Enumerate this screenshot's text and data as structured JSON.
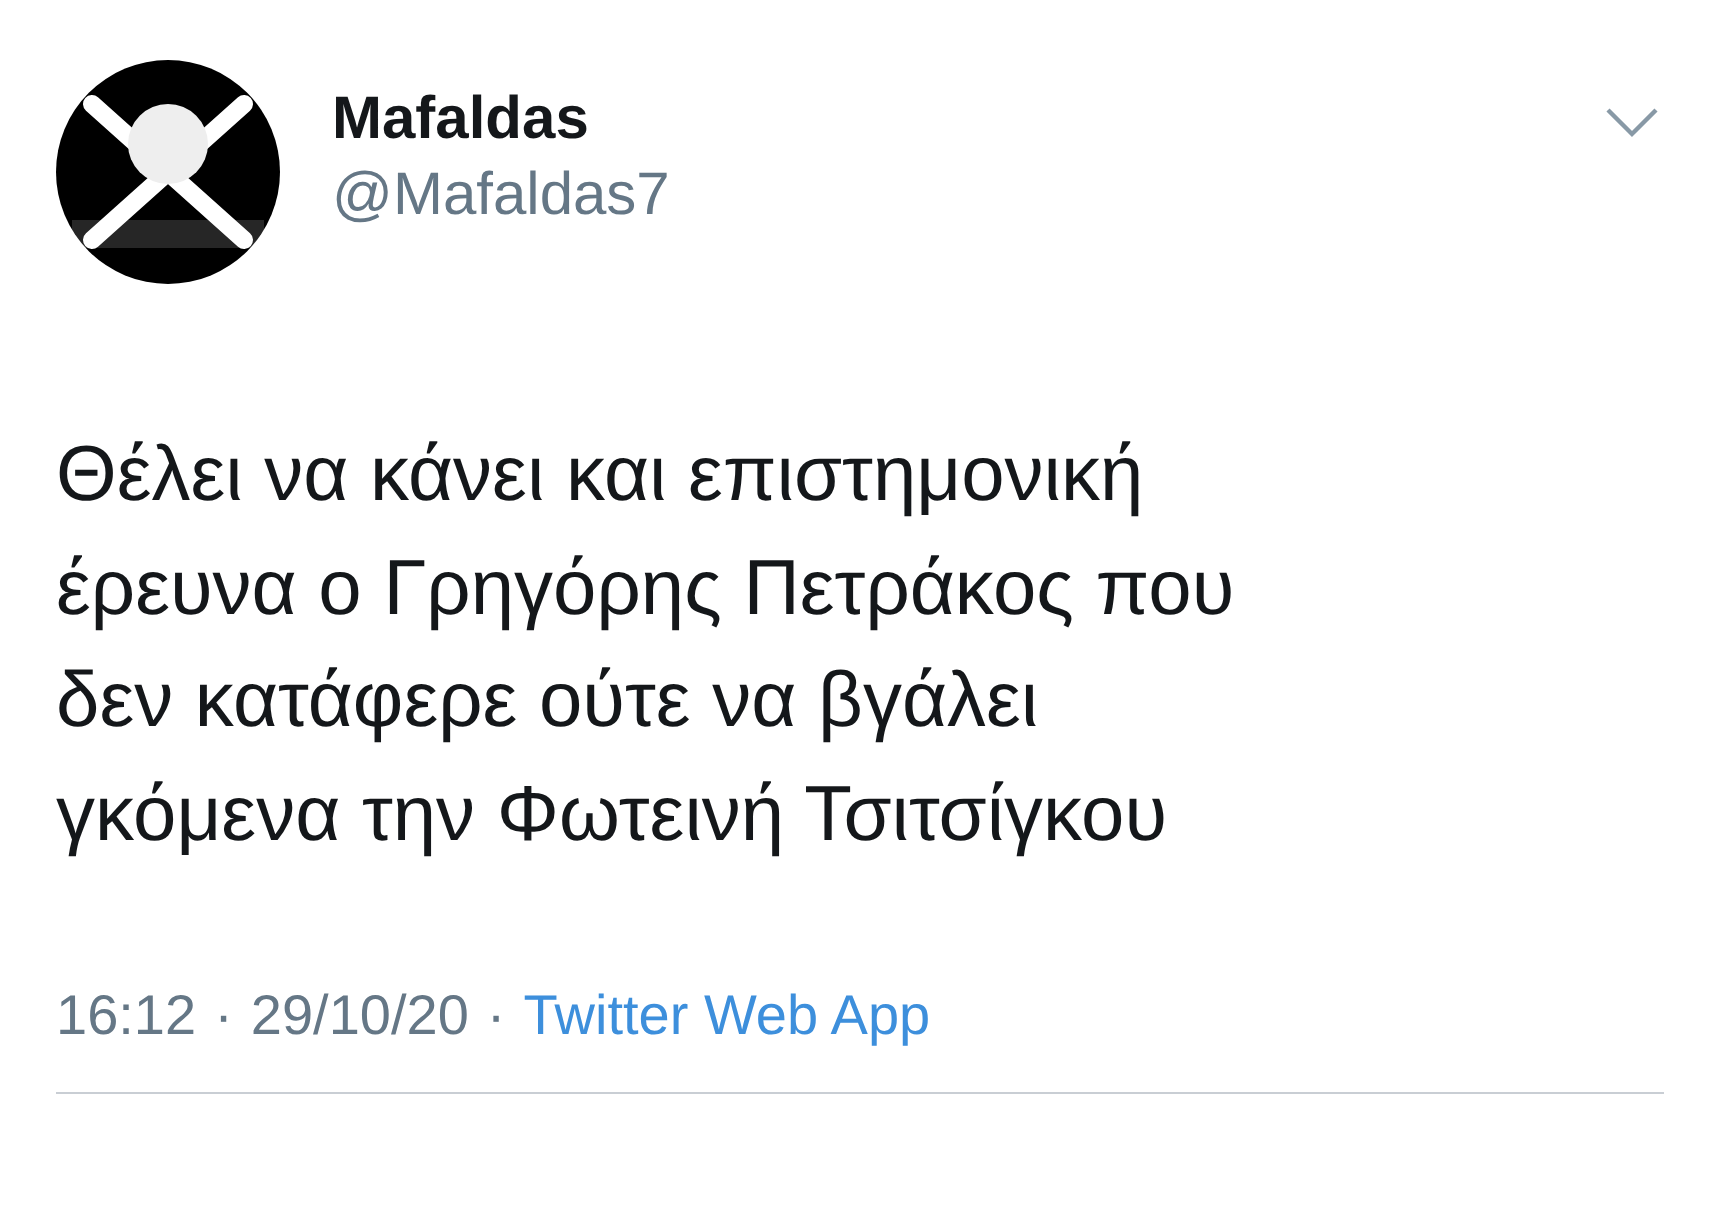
{
  "tweet": {
    "author": {
      "name": "Mafaldas",
      "handle": "@Mafaldas7"
    },
    "text_lines": [
      "Θέλει να κάνει και επιστημονική",
      "έρευνα ο Γρηγόρης Πετράκος που",
      "δεν κατάφερε ούτε να βγάλει",
      "γκόμενα την Φωτεινή Τσιτσίγκου"
    ],
    "time": "16:12",
    "separator": "·",
    "date": "29/10/20",
    "source": "Twitter Web App"
  }
}
